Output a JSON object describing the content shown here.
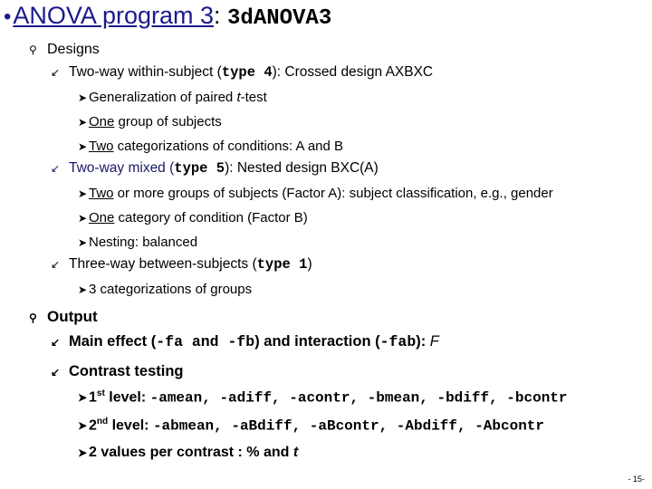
{
  "title": {
    "bullet": "•",
    "main": "ANOVA program 3",
    "sep": ": ",
    "program": "3dANOVA3"
  },
  "designs": {
    "label": "Designs",
    "within": {
      "pre": "Two-way within-subject (",
      "code": "type 4",
      "post": "): Crossed design AXBXC",
      "items": [
        {
          "u": "",
          "pre": "Generalization of paired ",
          "it": "t",
          "post": "-test"
        },
        {
          "u": "One",
          "text": " group of subjects"
        },
        {
          "u": "Two",
          "text": " categorizations of conditions: A and B"
        }
      ]
    },
    "mixed": {
      "pre": "Two-way mixed (",
      "code": "type 5",
      "post": "): Nested design BXC(A)",
      "items": [
        {
          "u": "Two",
          "text": " or more groups of subjects (Factor A): subject classification, e.g., gender"
        },
        {
          "u": "One",
          "text": " category of condition (Factor B)"
        },
        {
          "u": "",
          "text": "Nesting: balanced"
        }
      ]
    },
    "between": {
      "pre": "Three-way between-subjects (",
      "code": "type 1",
      "post": ")",
      "items": [
        {
          "u": "",
          "text": "3 categorizations of groups"
        }
      ]
    }
  },
  "output": {
    "label": "Output",
    "main_effect": {
      "pre": "Main effect (",
      "code1": "-fa and -fb",
      "mid": ") and interaction (",
      "code2": "-fab",
      "post": "): ",
      "it": "F"
    },
    "contrast": {
      "label": "Contrast testing",
      "level1": {
        "num": "1",
        "sup": "st",
        "label": " level: ",
        "code": "-amean, -adiff, -acontr, -bmean, -bdiff, -bcontr"
      },
      "level2": {
        "num": "2",
        "sup": "nd",
        "label": " level: ",
        "code": "-abmean, -aBdiff, -aBcontr, -Abdiff, -Abcontr"
      },
      "values": {
        "pre": "2 values per contrast : % and ",
        "it": "t"
      }
    }
  },
  "page_number": "- 15-",
  "icons": {
    "l1": "pin-icon",
    "l2": "arrow-icon",
    "l3": "chevron-icon"
  },
  "colors": {
    "title": "#1a1a8c"
  }
}
